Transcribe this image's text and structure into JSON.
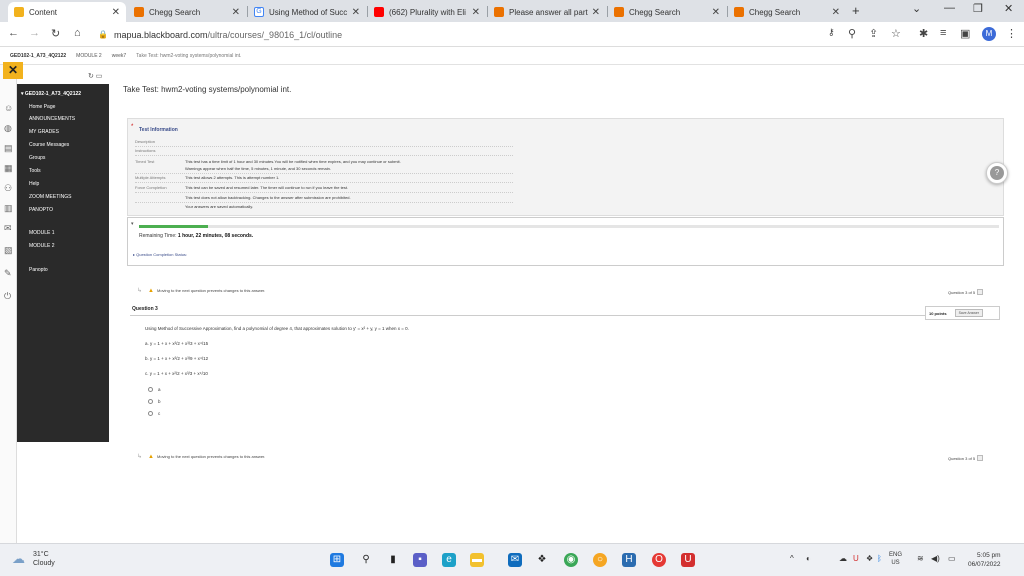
{
  "browser": {
    "tabs": [
      {
        "title": "Content",
        "fav_color": "#f2b21d",
        "active": true
      },
      {
        "title": "Chegg Search",
        "fav_color": "#eb7100"
      },
      {
        "title": "Using Method of Succ",
        "fav_color": "#4285f4"
      },
      {
        "title": "(662) Plurality with Eli",
        "fav_color": "#ff0000"
      },
      {
        "title": "Please answer all part",
        "fav_color": "#eb7100"
      },
      {
        "title": "Chegg Search",
        "fav_color": "#eb7100"
      },
      {
        "title": "Chegg Search",
        "fav_color": "#eb7100"
      }
    ],
    "url_host": "mapua.blackboard.com",
    "url_path": "/ultra/courses/_98016_1/cl/outline",
    "profile_initial": "M"
  },
  "breadcrumb": {
    "course": "GED102-1_A73_4Q2122",
    "module": "MODULE 2",
    "week": "week7",
    "page": "Take Test: hwm2-voting systems/polynomial int."
  },
  "nav": {
    "course_title": "GED102-1_A73_4Q2122",
    "items": [
      {
        "label": "Home Page"
      },
      {
        "label": "ANNOUNCEMENTS"
      },
      {
        "label": "MY GRADES"
      },
      {
        "label": "Course Messages"
      },
      {
        "label": "Groups"
      },
      {
        "label": "Tools"
      },
      {
        "label": "Help"
      },
      {
        "label": "ZOOM MEETINGS"
      },
      {
        "label": "PANOPTO"
      },
      {
        "label": "MODULE 1"
      },
      {
        "label": "MODULE 2"
      },
      {
        "label": "Panopto"
      }
    ]
  },
  "main": {
    "title": "Take Test: hwm2-voting systems/polynomial int.",
    "info": {
      "heading": "Test Information",
      "rows": [
        {
          "label": "Description",
          "value": ""
        },
        {
          "label": "Instructions",
          "value": ""
        },
        {
          "label": "Timed Test",
          "value": "This test has a time limit of 1 hour and 30 minutes.You will be notified when time expires, and you may continue or submit."
        },
        {
          "label": "",
          "value": "Warnings appear when half the time, 5 minutes, 1 minute, and 30 seconds remain."
        },
        {
          "label": "Multiple Attempts",
          "value": "This test allows 2 attempts. This is attempt number 1."
        },
        {
          "label": "Force Completion",
          "value": "This test can be saved and resumed later. The timer will continue to run if you leave the test."
        },
        {
          "label": "",
          "value": "This test does not allow backtracking. Changes to the answer after submission are prohibited."
        },
        {
          "label": "",
          "value": "Your answers are saved automatically."
        }
      ]
    },
    "timer": {
      "label": "Remaining Time:",
      "value": "1 hour, 22 minutes, 08 seconds.",
      "remaining_fraction": 0.08
    },
    "completion_label": "Question Completion Status:",
    "warning_text": "Moving to the next question prevents changes to this answer.",
    "question_counter": "Question 3 of 5",
    "question": {
      "title": "Question 3",
      "points": "10 points",
      "save_label": "Save Answer",
      "text": "Using Method of Successive Approximation, find a polynomial of degree 4, that approximates solution to y' = x² + y, y = 1 when x = 0.",
      "choices": [
        "a.  y = 1 + x + x²/2 + x³/3 + x⁴/15",
        "b.  y = 1 + x + x²/2 + x³/9 + x⁴/12",
        "c.  y = 1 + x + x²/2 + x³/3 + x⁴/10"
      ],
      "options": [
        "a",
        "b",
        "c"
      ]
    }
  },
  "taskbar": {
    "temp": "31°C",
    "condition": "Cloudy",
    "lang": "ENG",
    "region": "US",
    "time": "5:05 pm",
    "date": "06/07/2022"
  }
}
